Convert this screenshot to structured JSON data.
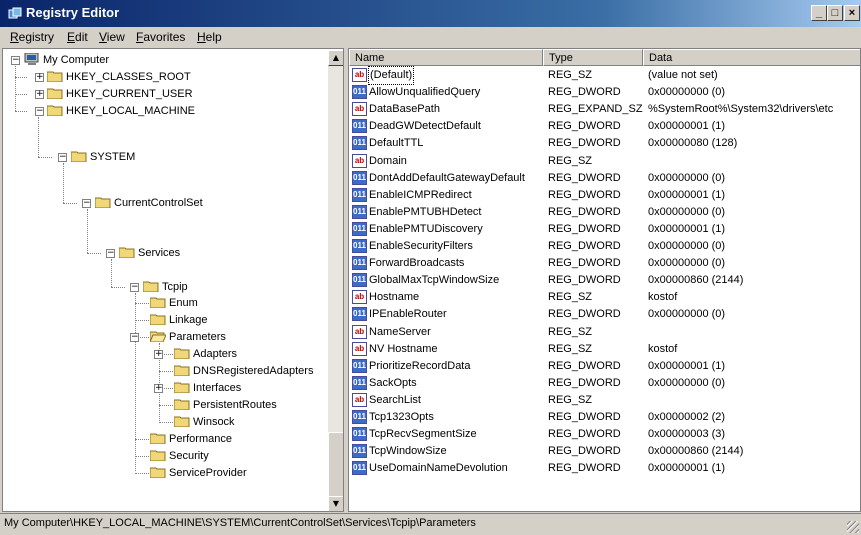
{
  "window": {
    "title": "Registry Editor",
    "controls": [
      "_",
      "□",
      "×"
    ]
  },
  "menu": [
    "Registry",
    "Edit",
    "View",
    "Favorites",
    "Help"
  ],
  "tree": [
    {
      "label": "My Computer",
      "expander": "−",
      "icon": "computer-icon"
    },
    {
      "label": "HKEY_CLASSES_ROOT",
      "expander": "+"
    },
    {
      "label": "HKEY_CURRENT_USER",
      "expander": "+"
    },
    {
      "label": "HKEY_LOCAL_MACHINE",
      "expander": "−"
    },
    {
      "label": "SYSTEM",
      "expander": "−"
    },
    {
      "label": "CurrentControlSet",
      "expander": "−"
    },
    {
      "label": "Services",
      "expander": "−"
    },
    {
      "label": "Tcpip",
      "expander": "−"
    },
    {
      "label": "Enum",
      "expander": ""
    },
    {
      "label": "Linkage",
      "expander": ""
    },
    {
      "label": "Parameters",
      "expander": "−",
      "open": true
    },
    {
      "label": "Adapters",
      "expander": "+"
    },
    {
      "label": "DNSRegisteredAdapters",
      "expander": ""
    },
    {
      "label": "Interfaces",
      "expander": "+"
    },
    {
      "label": "PersistentRoutes",
      "expander": ""
    },
    {
      "label": "Winsock",
      "expander": ""
    },
    {
      "label": "Performance",
      "expander": ""
    },
    {
      "label": "Security",
      "expander": ""
    },
    {
      "label": "ServiceProvider",
      "expander": ""
    }
  ],
  "columns": [
    "Name",
    "Type",
    "Data"
  ],
  "values": [
    {
      "name": "(Default)",
      "type": "REG_SZ",
      "data": "(value not set)",
      "icon": "sz"
    },
    {
      "name": "AllowUnqualifiedQuery",
      "type": "REG_DWORD",
      "data": "0x00000000 (0)",
      "icon": "dw"
    },
    {
      "name": "DataBasePath",
      "type": "REG_EXPAND_SZ",
      "data": "%SystemRoot%\\System32\\drivers\\etc",
      "icon": "sz"
    },
    {
      "name": "DeadGWDetectDefault",
      "type": "REG_DWORD",
      "data": "0x00000001 (1)",
      "icon": "dw"
    },
    {
      "name": "DefaultTTL",
      "type": "REG_DWORD",
      "data": "0x00000080 (128)",
      "icon": "dw"
    },
    {
      "name": "Domain",
      "type": "REG_SZ",
      "data": "",
      "icon": "sz"
    },
    {
      "name": "DontAddDefaultGatewayDefault",
      "type": "REG_DWORD",
      "data": "0x00000000 (0)",
      "icon": "dw"
    },
    {
      "name": "EnableICMPRedirect",
      "type": "REG_DWORD",
      "data": "0x00000001 (1)",
      "icon": "dw"
    },
    {
      "name": "EnablePMTUBHDetect",
      "type": "REG_DWORD",
      "data": "0x00000000 (0)",
      "icon": "dw"
    },
    {
      "name": "EnablePMTUDiscovery",
      "type": "REG_DWORD",
      "data": "0x00000001 (1)",
      "icon": "dw"
    },
    {
      "name": "EnableSecurityFilters",
      "type": "REG_DWORD",
      "data": "0x00000000 (0)",
      "icon": "dw"
    },
    {
      "name": "ForwardBroadcasts",
      "type": "REG_DWORD",
      "data": "0x00000000 (0)",
      "icon": "dw"
    },
    {
      "name": "GlobalMaxTcpWindowSize",
      "type": "REG_DWORD",
      "data": "0x00000860 (2144)",
      "icon": "dw"
    },
    {
      "name": "Hostname",
      "type": "REG_SZ",
      "data": "kostof",
      "icon": "sz"
    },
    {
      "name": "IPEnableRouter",
      "type": "REG_DWORD",
      "data": "0x00000000 (0)",
      "icon": "dw"
    },
    {
      "name": "NameServer",
      "type": "REG_SZ",
      "data": "",
      "icon": "sz"
    },
    {
      "name": "NV Hostname",
      "type": "REG_SZ",
      "data": "kostof",
      "icon": "sz"
    },
    {
      "name": "PrioritizeRecordData",
      "type": "REG_DWORD",
      "data": "0x00000001 (1)",
      "icon": "dw"
    },
    {
      "name": "SackOpts",
      "type": "REG_DWORD",
      "data": "0x00000000 (0)",
      "icon": "dw"
    },
    {
      "name": "SearchList",
      "type": "REG_SZ",
      "data": "",
      "icon": "sz"
    },
    {
      "name": "Tcp1323Opts",
      "type": "REG_DWORD",
      "data": "0x00000002 (2)",
      "icon": "dw"
    },
    {
      "name": "TcpRecvSegmentSize",
      "type": "REG_DWORD",
      "data": "0x00000003 (3)",
      "icon": "dw"
    },
    {
      "name": "TcpWindowSize",
      "type": "REG_DWORD",
      "data": "0x00000860 (2144)",
      "icon": "dw"
    },
    {
      "name": "UseDomainNameDevolution",
      "type": "REG_DWORD",
      "data": "0x00000001 (1)",
      "icon": "dw"
    }
  ],
  "status": "My Computer\\HKEY_LOCAL_MACHINE\\SYSTEM\\CurrentControlSet\\Services\\Tcpip\\Parameters",
  "colors": {
    "title_start": "#0a246a",
    "title_end": "#a6caf0",
    "chrome": "#d4d0c8",
    "folder": "#f0d878"
  }
}
